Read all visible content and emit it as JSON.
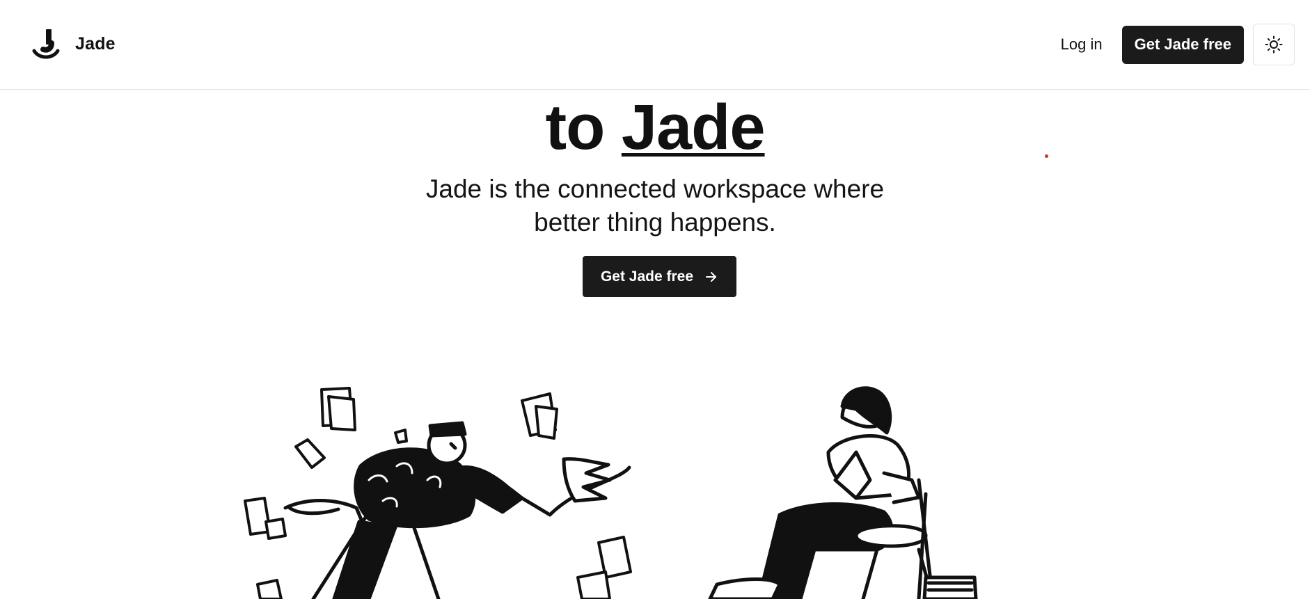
{
  "brand": {
    "name": "Jade",
    "logo_icon": "jade-j-logo-icon"
  },
  "nav": {
    "login_label": "Log in",
    "cta_label": "Get Jade free",
    "theme_toggle_icon": "sun-icon"
  },
  "hero": {
    "heading_prefix": "to",
    "heading_brand": "Jade",
    "subtitle_line1": "Jade is the connected workspace where",
    "subtitle_line2": "better thing happens.",
    "cta_label": "Get Jade free",
    "cta_icon": "arrow-right-icon"
  },
  "colors": {
    "text": "#111111",
    "button_bg": "#1b1b1b",
    "button_text": "#ffffff",
    "accent_dot": "#e0262b"
  }
}
